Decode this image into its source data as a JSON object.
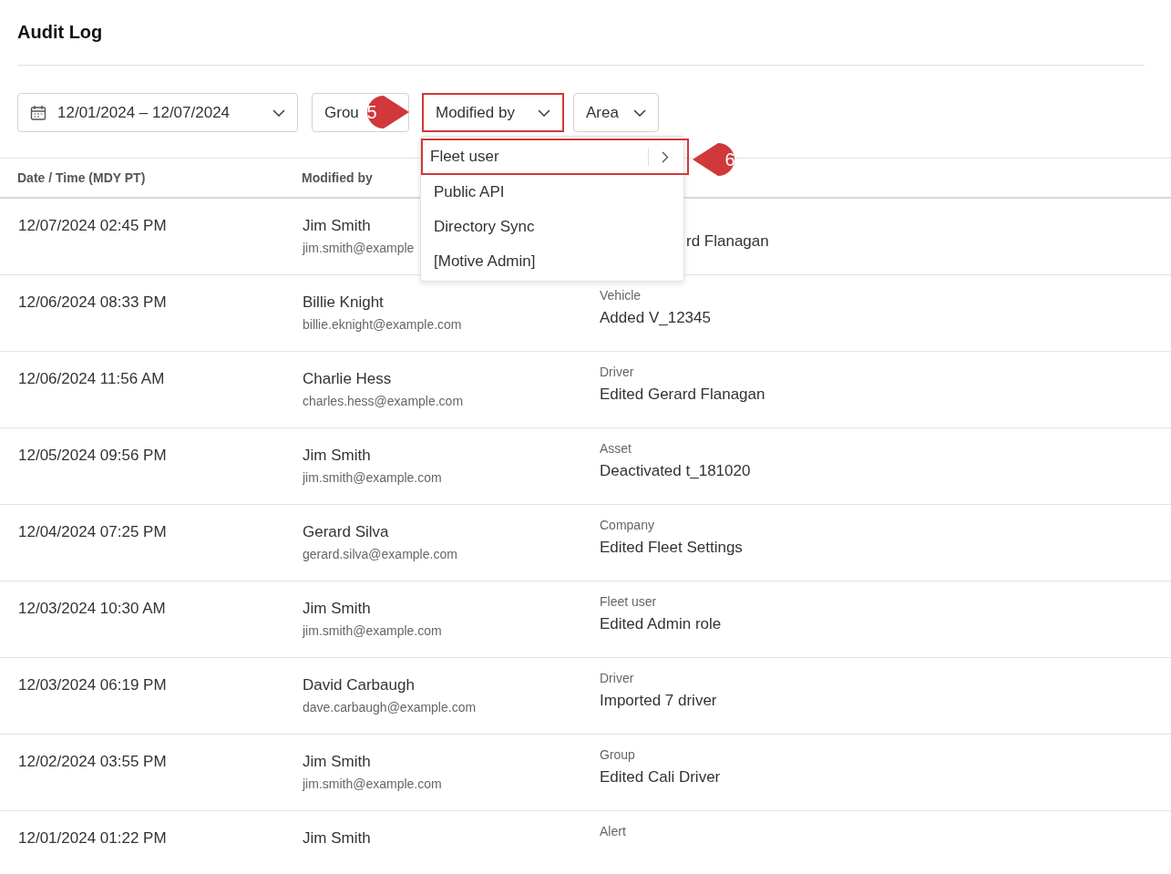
{
  "title": "Audit Log",
  "filters": [
    {
      "kind": "date",
      "label": "12/01/2024 – 12/07/2024",
      "highlighted": false
    },
    {
      "kind": "plain",
      "label": "Grou",
      "highlighted": false
    },
    {
      "kind": "dropdown",
      "label": "Modified by",
      "highlighted": true,
      "callout": "5"
    },
    {
      "kind": "dropdown",
      "label": "Area",
      "highlighted": false
    }
  ],
  "menu": {
    "items": [
      {
        "label": "Fleet user",
        "submenu": true,
        "highlighted": true,
        "callout": "6"
      },
      {
        "label": "Public API",
        "submenu": false,
        "highlighted": false
      },
      {
        "label": "Directory Sync",
        "submenu": false,
        "highlighted": false
      },
      {
        "label": "[Motive Admin]",
        "submenu": false,
        "highlighted": false
      }
    ]
  },
  "table": {
    "columns": [
      "Date / Time (MDY PT)",
      "Modified by"
    ],
    "rows": [
      {
        "time": "12/07/2024 02:45 PM",
        "name": "Jim Smith",
        "email": "jim.smith@example",
        "action": "rd Flanagan",
        "covered": true
      },
      {
        "time": "12/06/2024 08:33 PM",
        "name": "Billie Knight",
        "email": "billie.eknight@example.com",
        "area": "Vehicle",
        "action": "Added V_12345"
      },
      {
        "time": "12/06/2024 11:56 AM",
        "name": "Charlie Hess",
        "email": "charles.hess@example.com",
        "area": "Driver",
        "action": "Edited Gerard Flanagan"
      },
      {
        "time": "12/05/2024 09:56 PM",
        "name": "Jim Smith",
        "email": "jim.smith@example.com",
        "area": "Asset",
        "action": "Deactivated t_181020"
      },
      {
        "time": "12/04/2024 07:25 PM",
        "name": "Gerard Silva",
        "email": "gerard.silva@example.com",
        "area": "Company",
        "action": "Edited Fleet Settings"
      },
      {
        "time": "12/03/2024 10:30 AM",
        "name": "Jim Smith",
        "email": "jim.smith@example.com",
        "area": "Fleet user",
        "action": "Edited Admin role"
      },
      {
        "time": "12/03/2024 06:19 PM",
        "name": "David Carbaugh",
        "email": "dave.carbaugh@example.com",
        "area": "Driver",
        "action": "Imported 7 driver"
      },
      {
        "time": "12/02/2024 03:55 PM",
        "name": "Jim Smith",
        "email": "jim.smith@example.com",
        "area": "Group",
        "action": "Edited Cali Driver"
      },
      {
        "time": "12/01/2024 01:22 PM",
        "name": "Jim Smith",
        "area": "Alert"
      }
    ]
  }
}
